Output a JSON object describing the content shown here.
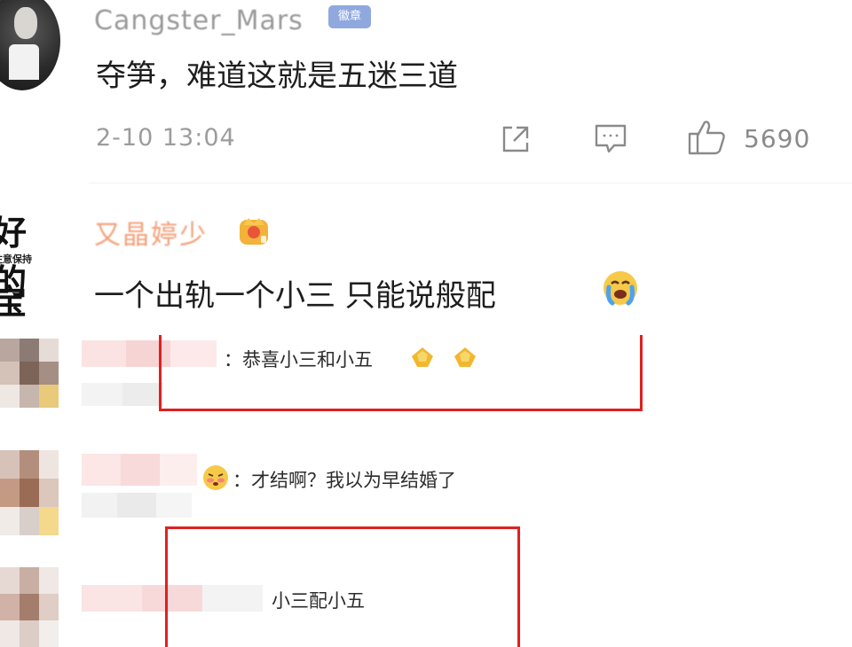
{
  "top_comment": {
    "username": "Cangster_Mars",
    "badge": "徽章",
    "text": "夺笋，难道这就是五迷三道",
    "time": "2-10 13:04",
    "like_count": "5690"
  },
  "second_comment": {
    "username": "又晶婷少",
    "avatar_line1": "好的",
    "avatar_line2": "注意保持",
    "avatar_line3": "宝贝",
    "text": "一个出轨一个小三 只能说般配"
  },
  "replies": [
    {
      "text": "：恭喜小三和小五"
    },
    {
      "text": "：才结啊？我以为早结婚了"
    },
    {
      "text": "小三配小五"
    }
  ],
  "colors": {
    "highlight_box": "#e02020",
    "vip_badge": "#8fa9df",
    "secondary_text": "#9c9c9c"
  },
  "icons": [
    "share-icon",
    "reply-icon",
    "like-icon",
    "crown-badge-icon",
    "crying-emoji-icon",
    "flame-emoji-icon",
    "shy-emoji-icon"
  ]
}
